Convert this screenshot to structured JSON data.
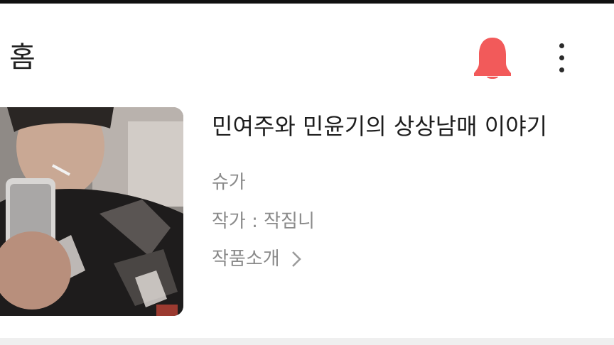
{
  "header": {
    "title": "홈",
    "bell_icon": "bell-icon",
    "bell_color": "#f25a5a",
    "more_icon": "more-vertical-icon"
  },
  "story": {
    "title": "민여주와 민윤기의 상상남매 이야기",
    "genre": "슈가",
    "author": "작가 : 작짐니",
    "intro_label": "작품소개",
    "intro_icon": "chevron-right-icon"
  }
}
